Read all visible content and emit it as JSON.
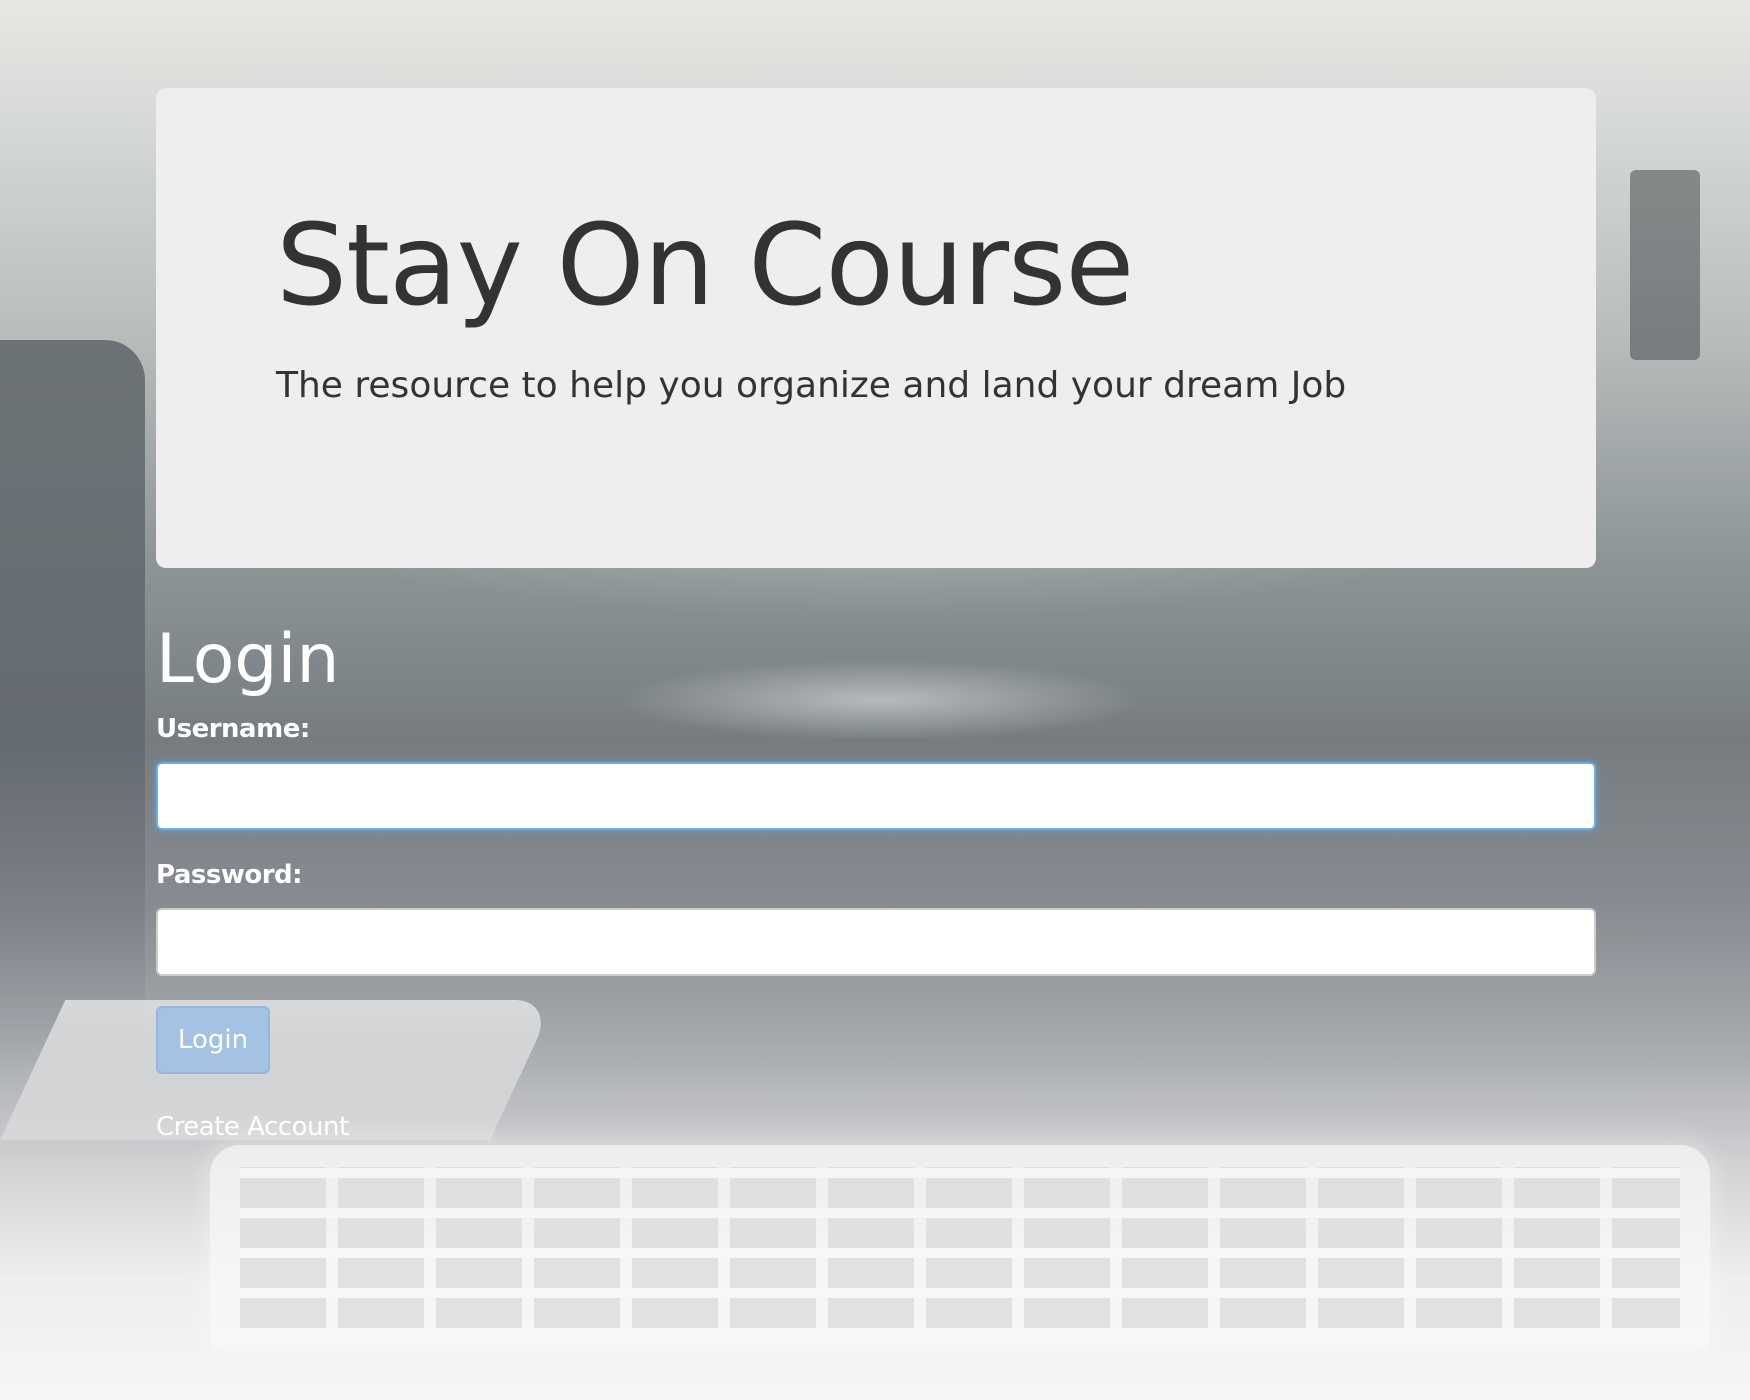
{
  "hero": {
    "title": "Stay On Course",
    "subtitle": "The resource to help you organize and land your dream Job"
  },
  "login": {
    "heading": "Login",
    "username_label": "Username:",
    "username_value": "",
    "password_label": "Password:",
    "password_value": "",
    "submit_label": "Login",
    "create_account_label": "Create Account"
  },
  "colors": {
    "hero_background": "#eeeeee",
    "hero_text": "#333333",
    "form_text": "#ffffff",
    "focus_border": "#66afe9",
    "button_background": "#a4c3e4"
  }
}
